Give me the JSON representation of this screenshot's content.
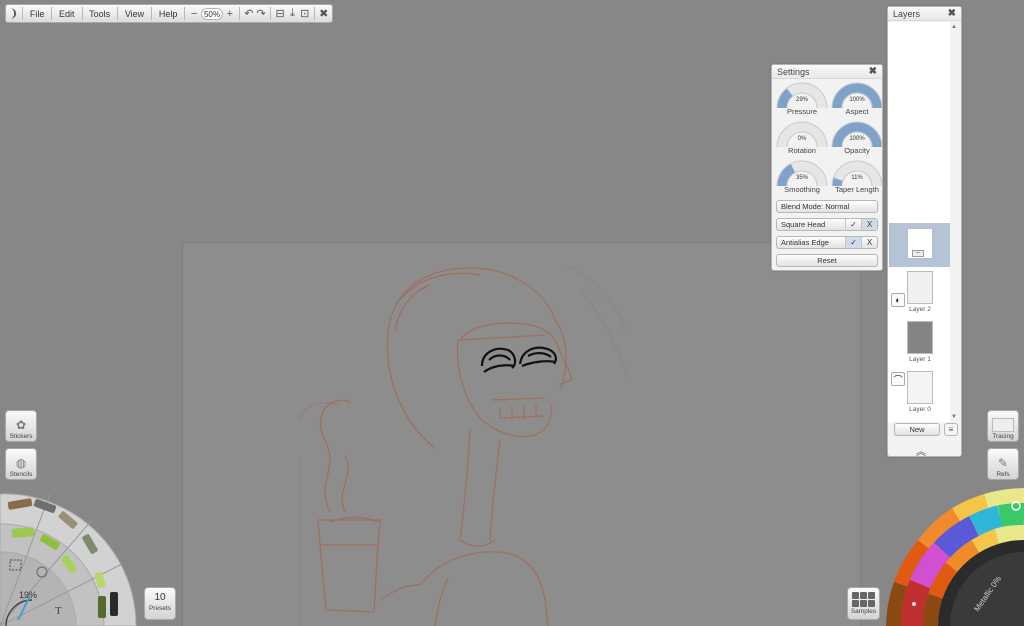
{
  "menu": {
    "items": [
      "File",
      "Edit",
      "Tools",
      "View",
      "Help"
    ],
    "zoom": "50%",
    "zoom_minus": "−",
    "zoom_plus": "+"
  },
  "settings": {
    "title": "Settings",
    "dials": [
      {
        "value": "29%",
        "label": "Pressure",
        "level": 0.29
      },
      {
        "value": "100%",
        "label": "Aspect",
        "level": 1.0
      },
      {
        "value": "0%",
        "label": "Rotation",
        "level": 0.0
      },
      {
        "value": "100%",
        "label": "Opacity",
        "level": 1.0
      },
      {
        "value": "35%",
        "label": "Smoothing",
        "level": 0.35
      },
      {
        "value": "11%",
        "label": "Taper Length",
        "level": 0.11
      }
    ],
    "blend_mode": "Blend Mode:  Normal",
    "square_head": "Square Head",
    "antialias_edge": "Antialias Edge",
    "check": "✓",
    "cross": "X",
    "reset": "Reset"
  },
  "layers": {
    "title": "Layers",
    "items": [
      {
        "name": "Layer 2"
      },
      {
        "name": "Layer 1"
      },
      {
        "name": "Layer 0"
      }
    ],
    "new_label": "New"
  },
  "left_tools": {
    "stickers": "Stickers",
    "stencils": "Stencils",
    "brush_size": "19%",
    "presets_count": "10",
    "presets_label": "Presets"
  },
  "right_tools": {
    "tracing": "Tracing",
    "refs": "Refs",
    "samples": "Samples",
    "metallic": "Metallic 0%"
  },
  "colors": {
    "background": "#878787",
    "sketch": "#a36a58",
    "ink": "#111111",
    "selected_layer": "#b4c3d6"
  }
}
